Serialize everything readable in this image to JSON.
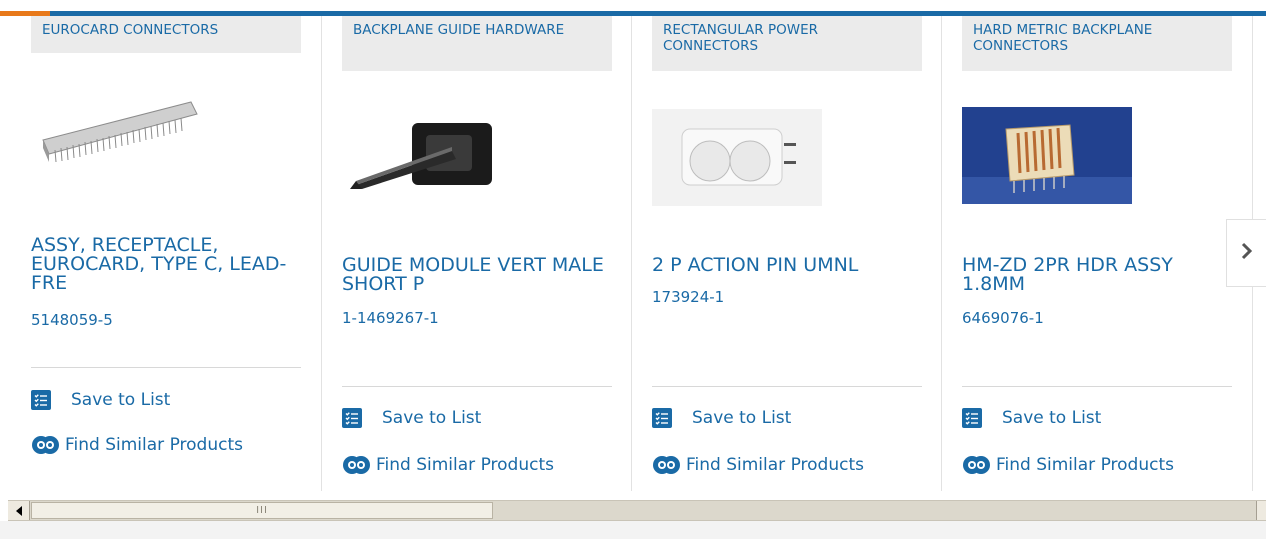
{
  "colors": {
    "brand": "#1a6aa6",
    "accent": "#e8791a",
    "tag_bg": "#ebebeb"
  },
  "cards": [
    {
      "category": "EUROCARD CONNECTORS",
      "title": "ASSY, RECEPTACLE, EUROCARD, TYPE C, LEAD-FRE",
      "part_number": "5148059-5",
      "save_label": "Save to List",
      "similar_label": "Find Similar Products",
      "image_icon": "eurocard-connector-image"
    },
    {
      "category": "BACKPLANE GUIDE HARDWARE",
      "title": "GUIDE MODULE VERT MALE SHORT P",
      "part_number": "1-1469267-1",
      "save_label": "Save to List",
      "similar_label": "Find Similar Products",
      "image_icon": "guide-module-image"
    },
    {
      "category": "RECTANGULAR POWER CONNECTORS",
      "title": "2 P ACTION PIN UMNL",
      "part_number": "173924-1",
      "save_label": "Save to List",
      "similar_label": "Find Similar Products",
      "image_icon": "power-connector-image"
    },
    {
      "category": "HARD METRIC BACKPLANE CONNECTORS",
      "title": "HM-ZD 2PR HDR ASSY 1.8MM",
      "part_number": "6469076-1",
      "save_label": "Save to List",
      "similar_label": "Find Similar Products",
      "image_icon": "hard-metric-connector-image"
    }
  ],
  "carousel": {
    "next_icon": "chevron-right-icon"
  },
  "scrollbar": {
    "left_icon": "arrow-left-icon",
    "grip": "III"
  }
}
